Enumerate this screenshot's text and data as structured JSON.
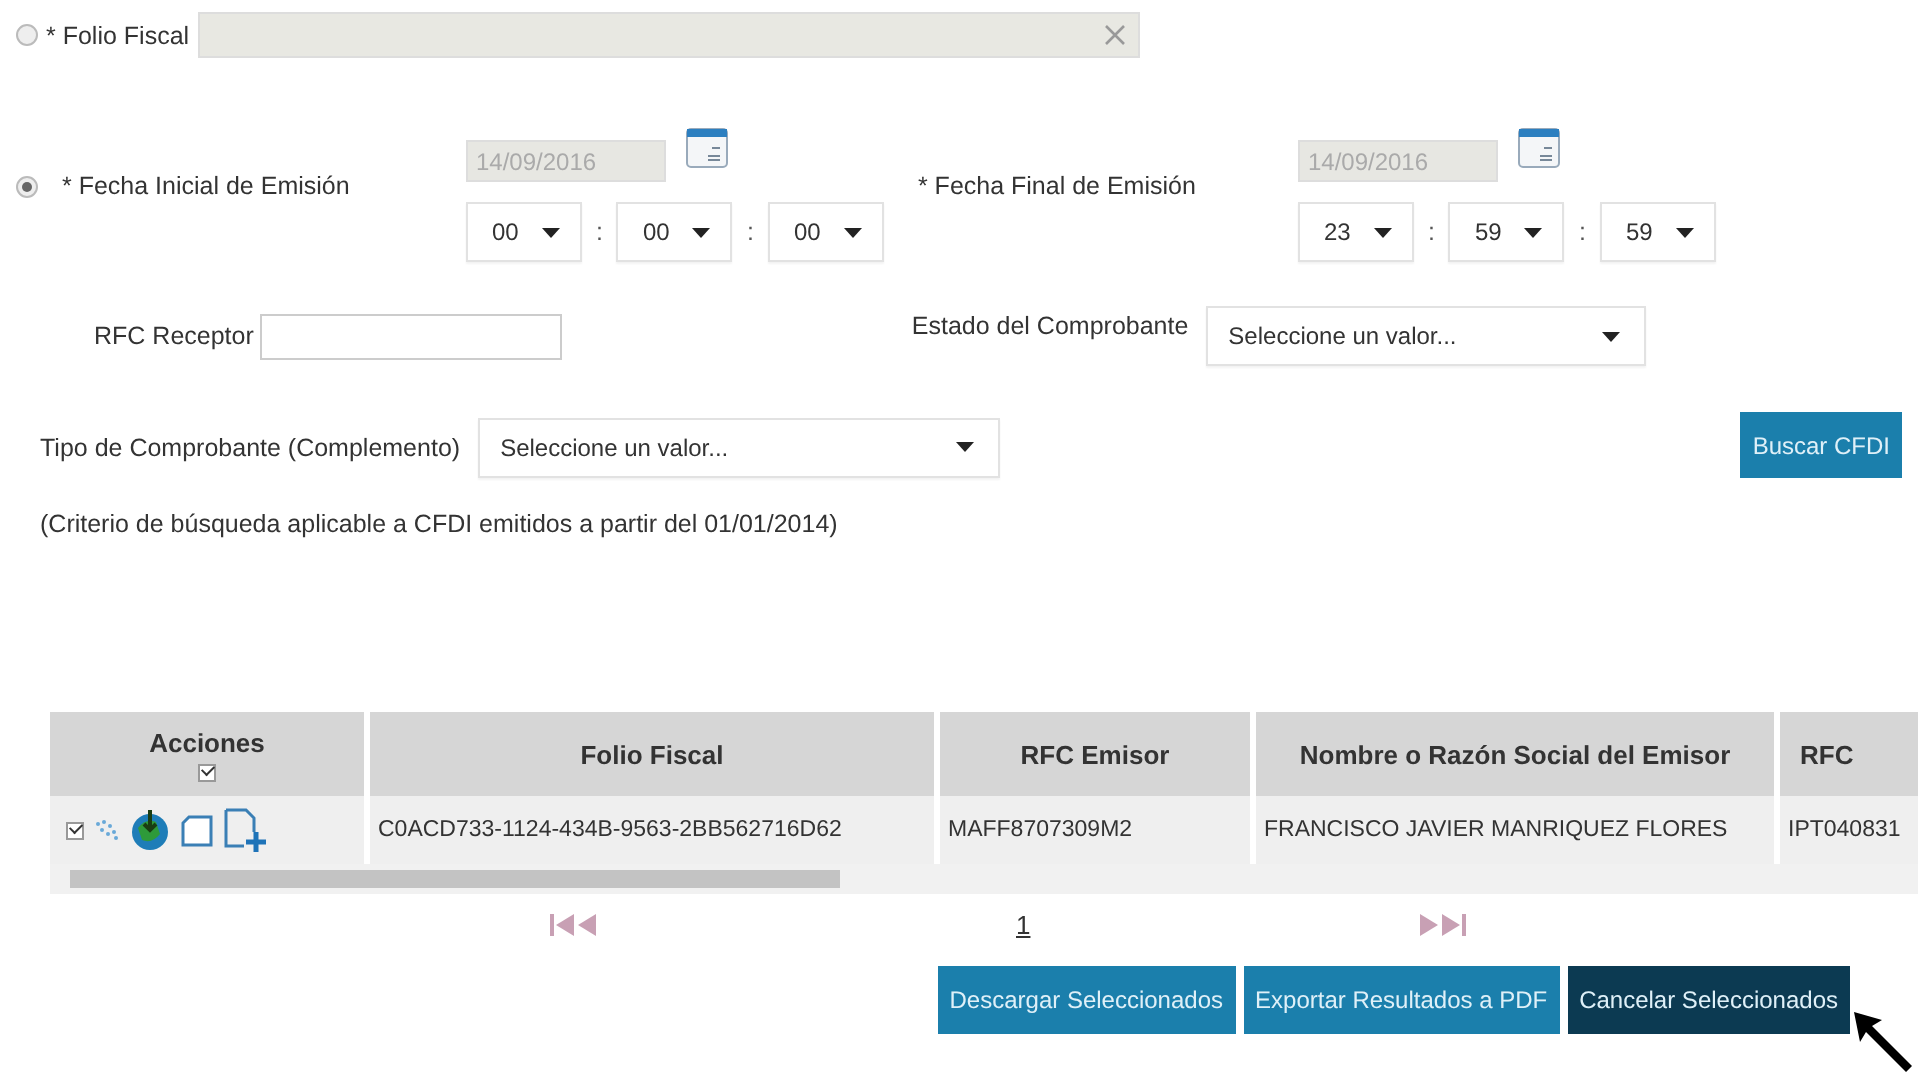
{
  "search_modes": [
    {
      "label": "* Folio Fiscal",
      "selected": false
    },
    {
      "label": "* Fecha Inicial de Emisión",
      "selected": true
    }
  ],
  "folio_field": {
    "disabled": true
  },
  "fecha_inicial": {
    "value": "14/09/2016",
    "disabled": true,
    "hour": "00",
    "minute": "00",
    "second": "00",
    "separators": [
      ":",
      ":"
    ]
  },
  "fecha_final": {
    "label": "* Fecha Final de Emisión",
    "value": "14/09/2016",
    "disabled": true,
    "hour": "23",
    "minute": "59",
    "second": "59",
    "separators": [
      ":",
      ":"
    ]
  },
  "rfc_receptor": {
    "label": "RFC Receptor"
  },
  "estado": {
    "label": "Estado del Comprobante",
    "value": "Seleccione un valor..."
  },
  "tipo": {
    "label": "Tipo de Comprobante (Complemento)",
    "value": "Seleccione un valor..."
  },
  "search_button": "Buscar CFDI",
  "note": "(Criterio de búsqueda aplicable a CFDI emitidos a partir del 01/01/2014)",
  "table": {
    "select_all": {
      "label": "Acciones",
      "checked": true
    },
    "columns": [
      "Folio Fiscal",
      "RFC Emisor",
      "Nombre o Razón Social del Emisor",
      "RFC"
    ],
    "rows": [
      {
        "checked": true,
        "cells": [
          "C0ACD733-1124-434B-9563-2BB562716D62",
          "MAFF8707309M2",
          "FRANCISCO JAVIER MANRIQUEZ FLORES",
          "IPT040831"
        ]
      }
    ]
  },
  "pager": {
    "page": "1"
  },
  "actions": [
    {
      "label": "Descargar Seleccionados",
      "active": false
    },
    {
      "label": "Exportar Resultados a PDF",
      "active": false
    },
    {
      "label": "Cancelar Seleccionados",
      "active": true
    }
  ]
}
